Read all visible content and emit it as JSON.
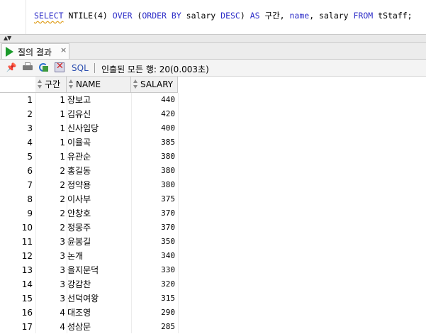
{
  "editor": {
    "tokens": [
      {
        "t": "SELECT",
        "k": true
      },
      {
        "t": " NTILE(4) ",
        "k": false
      },
      {
        "t": "OVER",
        "k": true
      },
      {
        "t": " (",
        "k": false
      },
      {
        "t": "ORDER BY",
        "k": true
      },
      {
        "t": " salary ",
        "k": false
      },
      {
        "t": "DESC",
        "k": true
      },
      {
        "t": ") ",
        "k": false
      },
      {
        "t": "AS",
        "k": true
      },
      {
        "t": " 구간, ",
        "k": false
      },
      {
        "t": "name",
        "k": true
      },
      {
        "t": ", salary ",
        "k": false
      },
      {
        "t": "FROM",
        "k": true
      },
      {
        "t": " tStaff;",
        "k": false
      }
    ],
    "keyword_color": "#2d2dc8"
  },
  "result_tab": {
    "label": "질의 결과",
    "close": "×"
  },
  "toolbar": {
    "sql_label": "SQL",
    "status": "인출된 모든 행: 20(0.003초)"
  },
  "grid": {
    "columns": [
      "구간",
      "NAME",
      "SALARY"
    ],
    "rows": [
      {
        "n": "1",
        "g": "1",
        "name": "장보고",
        "salary": "440"
      },
      {
        "n": "2",
        "g": "1",
        "name": "김유신",
        "salary": "420"
      },
      {
        "n": "3",
        "g": "1",
        "name": "신사임당",
        "salary": "400"
      },
      {
        "n": "4",
        "g": "1",
        "name": "이율곡",
        "salary": "385"
      },
      {
        "n": "5",
        "g": "1",
        "name": "유관순",
        "salary": "380"
      },
      {
        "n": "6",
        "g": "2",
        "name": "홍길동",
        "salary": "380"
      },
      {
        "n": "7",
        "g": "2",
        "name": "정약용",
        "salary": "380"
      },
      {
        "n": "8",
        "g": "2",
        "name": "이사부",
        "salary": "375"
      },
      {
        "n": "9",
        "g": "2",
        "name": "안창호",
        "salary": "370"
      },
      {
        "n": "10",
        "g": "2",
        "name": "정몽주",
        "salary": "370"
      },
      {
        "n": "11",
        "g": "3",
        "name": "윤봉길",
        "salary": "350"
      },
      {
        "n": "12",
        "g": "3",
        "name": "논개",
        "salary": "340"
      },
      {
        "n": "13",
        "g": "3",
        "name": "을지문덕",
        "salary": "330"
      },
      {
        "n": "14",
        "g": "3",
        "name": "강감찬",
        "salary": "320"
      },
      {
        "n": "15",
        "g": "3",
        "name": "선덕여왕",
        "salary": "315"
      },
      {
        "n": "16",
        "g": "4",
        "name": "대조영",
        "salary": "290"
      },
      {
        "n": "17",
        "g": "4",
        "name": "성삼문",
        "salary": "285"
      }
    ]
  }
}
